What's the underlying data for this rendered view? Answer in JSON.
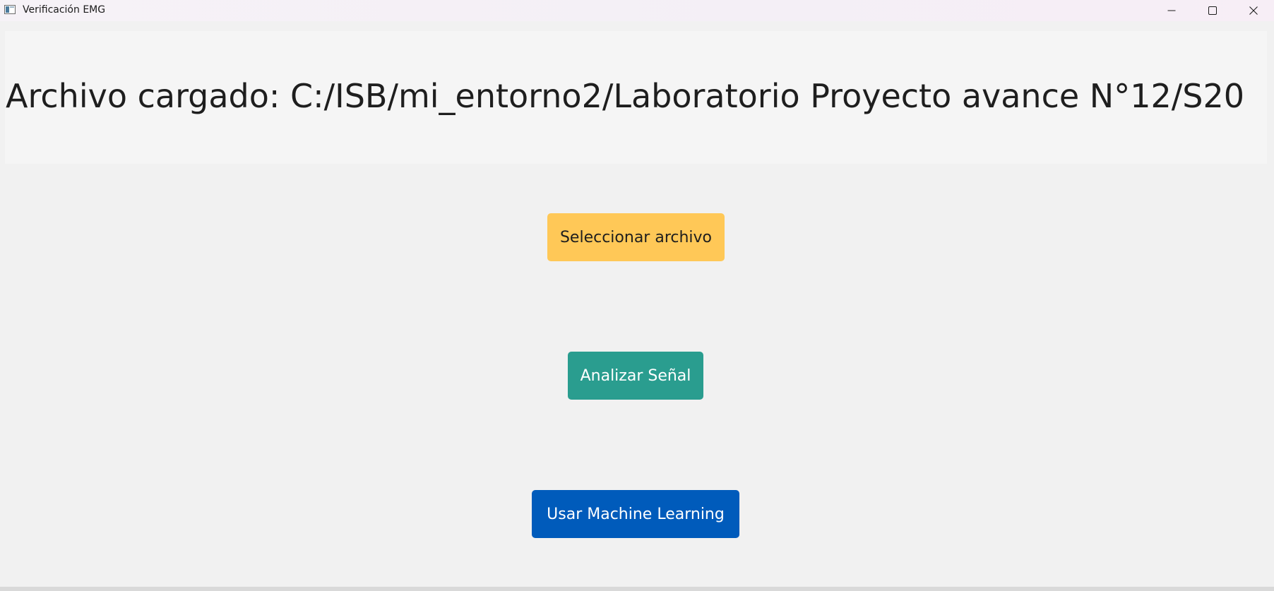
{
  "window": {
    "title": "Verificación EMG",
    "icon": "app-window-icon",
    "controls": {
      "minimize_icon": "minimize-icon",
      "maximize_icon": "maximize-icon",
      "close_icon": "close-icon"
    }
  },
  "header": {
    "status_text": "Archivo cargado: C:/ISB/mi_entorno2/Laboratorio Proyecto avance N°12/S20"
  },
  "actions": {
    "select_file": {
      "label": "Seleccionar archivo",
      "color": "#ffc857"
    },
    "analyze_signal": {
      "label": "Analizar Señal",
      "color": "#2a9d8f"
    },
    "machine_learning": {
      "label": "Usar Machine Learning",
      "color": "#005bbb"
    }
  }
}
